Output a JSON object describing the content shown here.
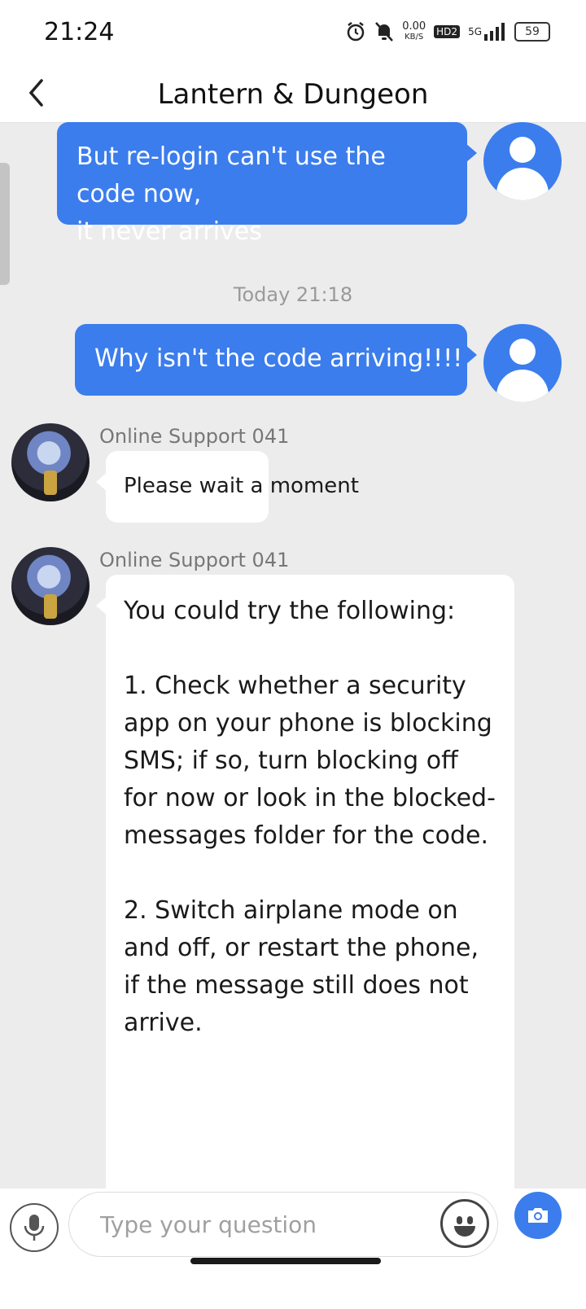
{
  "status_bar": {
    "time": "21:24",
    "net_speed": "0.00",
    "net_unit": "KB/S",
    "hd_label": "HD2",
    "signal_label": "5G",
    "battery": "59"
  },
  "header": {
    "title": "Lantern & Dungeon",
    "back_icon": "chevron-left-icon"
  },
  "messages": {
    "user_msg_1": {
      "line1": "But re-login can't use the code now,",
      "line2": "it never arrives"
    },
    "timestamp": "Today 21:18",
    "user_msg_2": {
      "text": "Why isn't the code arriving!!!!"
    },
    "agent_msg_1": {
      "name": "Online Support 041",
      "text": "Please wait a moment"
    },
    "agent_msg_2": {
      "name": "Online Support 041",
      "intro": "You could try the following:",
      "point1": "1. Check whether a security app on your phone is blocking SMS; if so, turn blocking off for now or look in the blocked-messages folder for the code.",
      "point2": "2. Switch airplane mode on and off, or restart the phone, if the message still does not arrive."
    }
  },
  "input_bar": {
    "placeholder": "Type your question",
    "mic_icon": "microphone-icon",
    "emoji_icon": "emoji-icon",
    "camera_icon": "camera-icon"
  },
  "colors": {
    "accent": "#3b7ded",
    "background": "#ececec",
    "bubble_white": "#ffffff"
  }
}
